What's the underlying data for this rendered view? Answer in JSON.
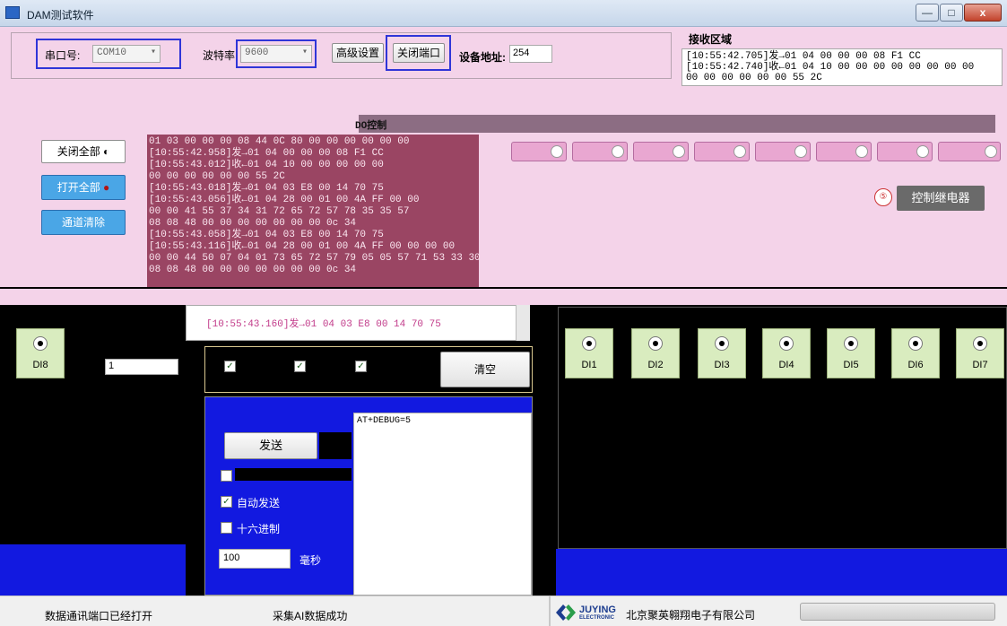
{
  "window": {
    "title": "DAM测试软件",
    "controls": {
      "min": "—",
      "max": "□",
      "close": "x"
    }
  },
  "settings": {
    "port_label": "串口号:",
    "port_value": "COM10",
    "baud_label": "波特率",
    "baud_value": "9600",
    "advanced_button": "高级设置",
    "close_port_button": "关闭端口",
    "address_label": "设备地址:",
    "address_value": "254"
  },
  "receive": {
    "title": "接收区域",
    "lines": "[10:55:42.705]发→01 04 00 00 00 08 F1 CC\n[10:55:42.740]收←01 04 10 00 00 00 00 00 00 00 00\n00 00 00 00 00 00 55 2C"
  },
  "do_section": {
    "label": "DO控制",
    "control_badge": "⑤",
    "control_label": "控制继电器"
  },
  "left_buttons": {
    "close_all": "关闭全部",
    "open_all": "打开全部",
    "clear_channel": "通道清除"
  },
  "log": {
    "lines": "01 03 00 00 00 08 44 0C 80 00 00 00 00 00 00\n[10:55:42.958]发→01 04 00 00 00 08 F1 CC\n[10:55:43.012]收←01 04 10 00 00 00 00 00\n00 00 00 00 00 00 55 2C\n[10:55:43.018]发→01 04 03 E8 00 14 70 75\n[10:55:43.056]收←01 04 28 00 01 00 4A FF 00 00\n00 00 41 55 37 34 31 72 65 72 57 78 35 35 57\n08 08 48 00 00 00 00 00 00 00 0c 34\n[10:55:43.058]发→01 04 03 E8 00 14 70 75\n[10:55:43.116]收←01 04 28 00 01 00 4A FF 00 00 00 00\n00 00 44 50 07 04 01 73 65 72 57 79 05 05 57 71 53 33 30\n08 08 48 00 00 00 00 00 00 00 0c 34",
    "last_line": "[10:55:43.160]发→01 04 03 E8 00 14 70 75"
  },
  "di": {
    "left_cells": [
      {
        "name": "DI8"
      }
    ],
    "left_input": "1",
    "right_cells": [
      {
        "name": "DI1"
      },
      {
        "name": "DI2"
      },
      {
        "name": "DI3"
      },
      {
        "name": "DI4"
      },
      {
        "name": "DI5"
      },
      {
        "name": "DI6"
      },
      {
        "name": "DI7"
      }
    ]
  },
  "send": {
    "clear_button": "清空",
    "send_button": "发送",
    "send_text": "AT+DEBUG=5",
    "opt_auto_send": "自动发送",
    "opt_hex_send": "十六进制",
    "interval_value": "100",
    "interval_unit": "毫秒"
  },
  "status": {
    "left": "数据通讯端口已经打开",
    "middle": "采集AI数据成功",
    "brand": "JUYING",
    "brand_sub": "ELECTRONIC",
    "company": "北京聚英翱翔电子有限公司"
  },
  "colors": {
    "accent_blue": "#1219e0",
    "highlight_box": "#2f35d8",
    "panel_pink": "#f4d3e9",
    "di_cell": "#d9ecbf"
  }
}
